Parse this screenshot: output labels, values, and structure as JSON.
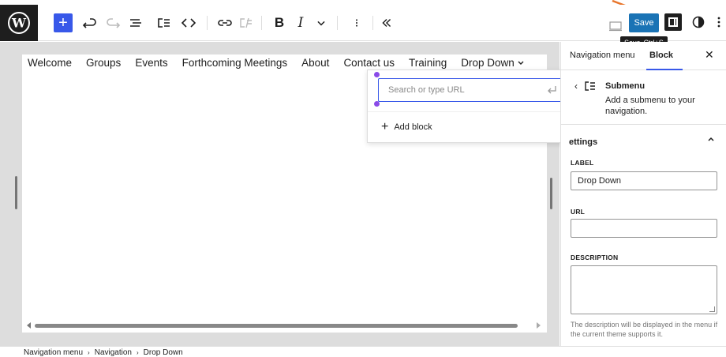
{
  "toolbar": {
    "save_label": "Save",
    "tooltip_label": "Save",
    "tooltip_shortcut": "Ctrl+S",
    "bold_label": "B",
    "italic_label": "I",
    "icons": [
      "wordpress-logo-icon",
      "plus-icon",
      "undo-icon",
      "redo-icon",
      "list-view-icon",
      "submenu-icon",
      "code-icon",
      "link-icon",
      "unlink-icon",
      "bold-icon",
      "italic-icon",
      "chevron-down-icon",
      "more-vertical-icon",
      "collapse-icon",
      "device-preview-icon",
      "sidebar-icon",
      "styles-icon",
      "options-icon"
    ]
  },
  "navigation": {
    "items": [
      "Welcome",
      "Groups",
      "Events",
      "Forthcoming Meetings",
      "About",
      "Contact us",
      "Training",
      "Drop Down"
    ]
  },
  "popover": {
    "url_placeholder": "Search or type URL",
    "add_block_label": "Add block"
  },
  "sidebar": {
    "tabs": [
      "Navigation menu",
      "Block"
    ],
    "block_title": "Submenu",
    "block_description": "Add a submenu to your navigation.",
    "settings_label": "ettings",
    "label_heading": "LABEL",
    "label_value": "Drop Down",
    "url_heading": "URL",
    "url_value": "",
    "description_heading": "DESCRIPTION",
    "description_value": "",
    "help_text": "The description will be displayed in the menu if the current theme supports it."
  },
  "breadcrumb": [
    "Navigation menu",
    "Navigation",
    "Drop Down"
  ],
  "colors": {
    "accent": "#3858e9",
    "save_button": "#1a73b5",
    "annotation_arrow": "#e8762c"
  }
}
